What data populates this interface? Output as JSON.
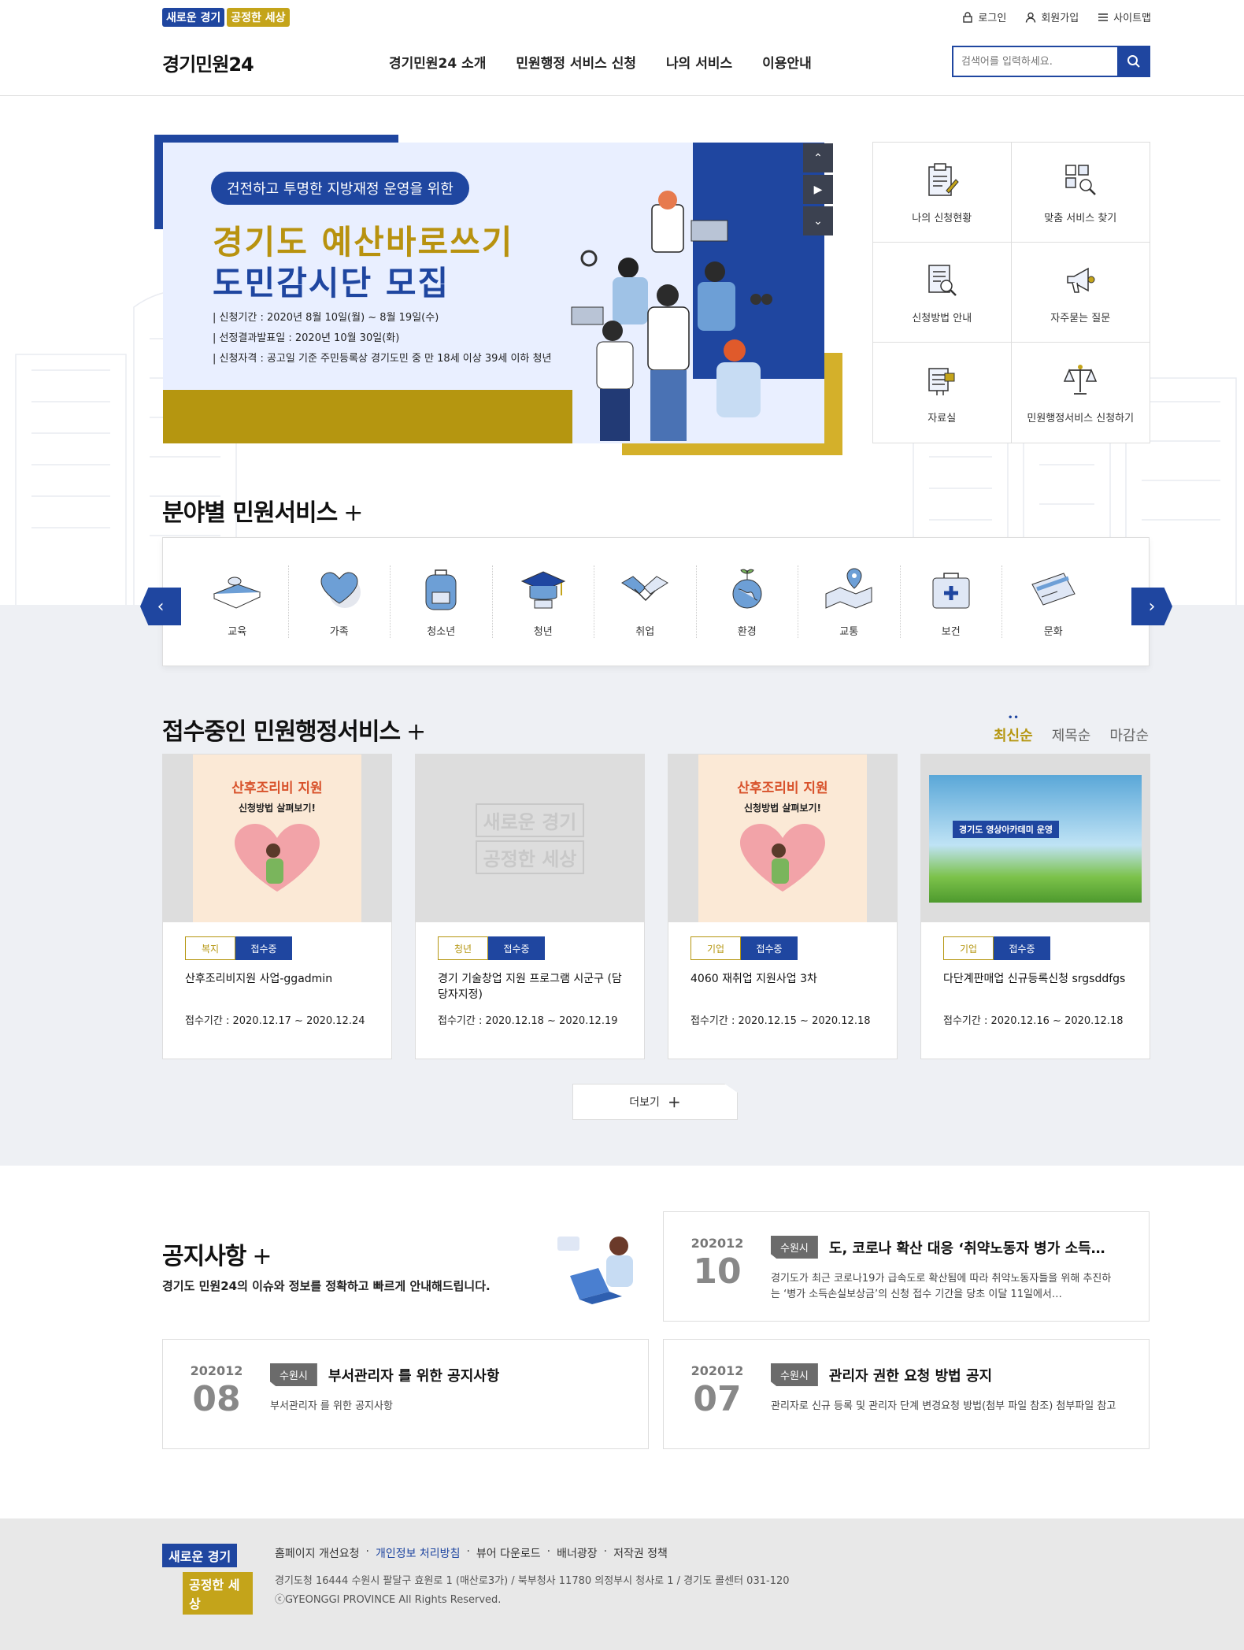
{
  "header": {
    "slogan_1": "새로운 경기",
    "slogan_2": "공정한 세상",
    "util": {
      "login": "로그인",
      "join": "회원가입",
      "sitemap": "사이트맵"
    },
    "logo": "경기민원24",
    "nav": [
      "경기민원24 소개",
      "민원행정 서비스 신청",
      "나의 서비스",
      "이용안내"
    ],
    "search_placeholder": "검색어를 입력하세요."
  },
  "banner": {
    "pill": "건전하고 투명한 지방재정 운영을 위한",
    "title_1": "경기도 예산바로쓰기",
    "title_2": "도민감시단 모집",
    "info": [
      "| 신청기간 : 2020년 8월 10일(월) ~ 8월 19일(수)",
      "| 선정결과발표일 : 2020년 10월 30일(화)",
      "| 신청자격 : 공고일 기준 주민등록상 경기도민 중 만 18세 이상 39세 이하 청년"
    ],
    "controls": [
      "up",
      "play",
      "down"
    ]
  },
  "quick": [
    {
      "label": "나의 신청현황",
      "icon": "clipboard-icon"
    },
    {
      "label": "맞춤 서비스 찾기",
      "icon": "grid-search-icon"
    },
    {
      "label": "신청방법 안내",
      "icon": "document-search-icon"
    },
    {
      "label": "자주묻는 질문",
      "icon": "megaphone-icon"
    },
    {
      "label": "자료실",
      "icon": "archive-icon"
    },
    {
      "label": "민원행정서비스 신청하기",
      "icon": "scale-icon"
    }
  ],
  "field_section": {
    "title": "분야별 민원서비스",
    "plus": "+",
    "items": [
      {
        "label": "교육",
        "icon": "book-icon"
      },
      {
        "label": "가족",
        "icon": "heart-icon"
      },
      {
        "label": "청소년",
        "icon": "backpack-icon"
      },
      {
        "label": "청년",
        "icon": "graduation-cap-icon"
      },
      {
        "label": "취업",
        "icon": "handshake-icon"
      },
      {
        "label": "환경",
        "icon": "globe-icon"
      },
      {
        "label": "교통",
        "icon": "map-pin-icon"
      },
      {
        "label": "보건",
        "icon": "medical-kit-icon"
      },
      {
        "label": "문화",
        "icon": "ticket-icon"
      }
    ]
  },
  "receiving": {
    "title": "접수중인 민원행정서비스",
    "plus": "+",
    "sort": [
      "최신순",
      "제목순",
      "마감순"
    ],
    "cards": [
      {
        "category": "복지",
        "status": "접수중",
        "title": "산후조리비지원 사업-ggadmin",
        "date": "접수기간 : 2020.12.17 ~ 2020.12.24",
        "thumb": "poster",
        "poster_title": "산후조리비 지원",
        "poster_sub": "신청방법 살펴보기!"
      },
      {
        "category": "청년",
        "status": "접수중",
        "title": "경기 기술창업 지원 프로그램 시군구 (담당자지정)",
        "date": "접수기간 : 2020.12.18 ~ 2020.12.19",
        "thumb": "placeholder",
        "placeholder_1": "새로운 경기",
        "placeholder_2": "공정한 세상"
      },
      {
        "category": "기업",
        "status": "접수중",
        "title": "4060 재취업 지원사업 3차",
        "date": "접수기간 : 2020.12.15 ~ 2020.12.18",
        "thumb": "poster",
        "poster_title": "산후조리비 지원",
        "poster_sub": "신청방법 살펴보기!"
      },
      {
        "category": "기업",
        "status": "접수중",
        "title": "다단계판매업 신규등록신청 srgsddfgs",
        "date": "접수기간 : 2020.12.16 ~ 2020.12.18",
        "thumb": "academy",
        "academy_title": "경기도 영상아카데미 운영"
      }
    ],
    "more": "더보기"
  },
  "notice": {
    "title": "공지사항",
    "plus": "+",
    "desc": "경기도 민원24의 이슈와 정보를 정확하고 빠르게 안내해드립니다.",
    "items": [
      {
        "ym": "202012",
        "day": "10",
        "badge": "수원시",
        "title": "도, 코로나 확산 대응 ‘취약노동자 병가 소득…",
        "desc": "경기도가 최근 코로나19가 급속도로 확산됨에 따라 취약노동자들을 위해 추진하는 ‘병가 소득손실보상금’의 신청 접수 기간을 당초 이달 11일에서…"
      },
      {
        "ym": "202012",
        "day": "08",
        "badge": "수원시",
        "title": "부서관리자 를 위한 공지사항",
        "desc": "부서관리자 를 위한 공지사항"
      },
      {
        "ym": "202012",
        "day": "07",
        "badge": "수원시",
        "title": "관리자 권한 요청 방법 공지",
        "desc": "관리자로 신규 등록 및 관리자 단계 변경요청 방법(첨부 파일 참조) 첨부파일 참고"
      }
    ]
  },
  "footer": {
    "logo_1": "새로운 경기",
    "logo_2": "공정한 세상",
    "links": [
      "홈페이지 개선요청",
      "개인정보 처리방침",
      "뷰어 다운로드",
      "배너광장",
      "저작권 정책"
    ],
    "address": "경기도청 16444 수원시 팔달구 효원로 1 (매산로3가) / 북부청사 11780 의정부시 청사로 1 / 경기도 콜센터 031-120",
    "copyright": "ⓒGYEONGGI PROVINCE All Rights Reserved."
  },
  "colors": {
    "primary": "#1f46a0",
    "gold": "#b59610",
    "bg_grey": "#eef0f4"
  }
}
